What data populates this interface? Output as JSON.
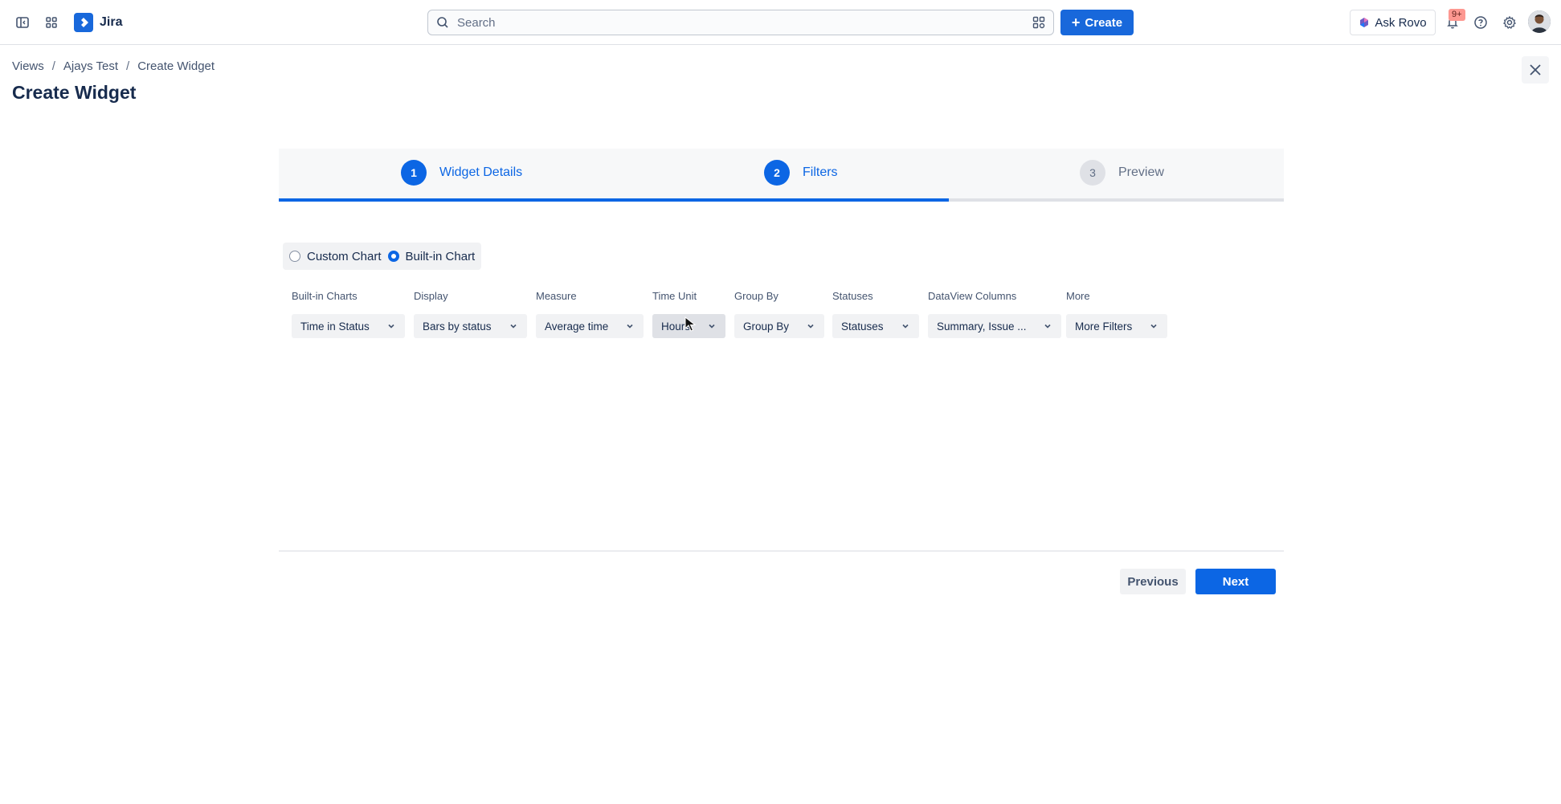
{
  "app": {
    "name": "Jira",
    "search_placeholder": "Search",
    "create_label": "Create",
    "rovo_label": "Ask Rovo",
    "notification_badge": "9+"
  },
  "breadcrumb": {
    "items": [
      "Views",
      "Ajays Test",
      "Create Widget"
    ],
    "separator": "/"
  },
  "page": {
    "title": "Create Widget"
  },
  "stepper": {
    "steps": [
      {
        "number": "1",
        "label": "Widget Details",
        "state": "complete"
      },
      {
        "number": "2",
        "label": "Filters",
        "state": "active"
      },
      {
        "number": "3",
        "label": "Preview",
        "state": "upcoming"
      }
    ],
    "progress_fraction": 0.667
  },
  "chart_type": {
    "options": [
      "Custom Chart",
      "Built-in Chart"
    ],
    "selected": "Built-in Chart"
  },
  "filters": [
    {
      "label": "Built-in Charts",
      "value": "Time in Status"
    },
    {
      "label": "Display",
      "value": "Bars by status"
    },
    {
      "label": "Measure",
      "value": "Average time"
    },
    {
      "label": "Time Unit",
      "value": "Hours"
    },
    {
      "label": "Group By",
      "value": "Group By"
    },
    {
      "label": "Statuses",
      "value": "Statuses"
    },
    {
      "label": "DataView Columns",
      "value": "Summary, Issue ..."
    },
    {
      "label": "More",
      "value": "More Filters"
    }
  ],
  "footer": {
    "previous_label": "Previous",
    "next_label": "Next"
  },
  "colors": {
    "primary": "#0c66e4",
    "text": "#172b4d",
    "subtle_text": "#44546f",
    "neutral_bg": "#f1f2f4"
  }
}
